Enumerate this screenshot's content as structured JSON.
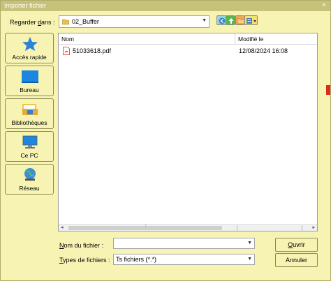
{
  "window": {
    "title": "Importer fichier",
    "close_glyph": "×"
  },
  "lookin": {
    "label_prefix": "Regarder ",
    "label_accel": "d",
    "label_suffix": "ans :",
    "value": "02_Buffer",
    "folder_icon": "folder-icon"
  },
  "toolbar": {
    "icons": [
      "back-icon",
      "up-folder-icon",
      "new-folder-icon",
      "view-menu-icon"
    ]
  },
  "places": [
    {
      "label": "Accès rapide",
      "icon": "star-icon"
    },
    {
      "label": "Bureau",
      "icon": "desktop-icon"
    },
    {
      "label": "Bibliothèques",
      "icon": "library-icon"
    },
    {
      "label": "Ce PC",
      "icon": "computer-icon"
    },
    {
      "label": "Réseau",
      "icon": "network-icon"
    }
  ],
  "filelist": {
    "columns": [
      "Nom",
      "Modifié le"
    ],
    "rows": [
      {
        "name": "51033618.pdf",
        "modified": "12/08/2024 16:08",
        "icon": "pdf-icon"
      }
    ]
  },
  "form": {
    "filename_label_accel": "N",
    "filename_label_rest": "om du fichier :",
    "filename_value": "",
    "filetype_label_accel": "T",
    "filetype_label_rest": "ypes de fichiers :",
    "filetype_value": "Ts fichiers (*.*)"
  },
  "buttons": {
    "open_accel": "O",
    "open_rest": "uvrir",
    "cancel": "Annuler"
  },
  "colors": {
    "window_bg": "#f6f3b3",
    "titlebar_bg": "#c6c27a",
    "pdf_red": "#dd2b1d"
  }
}
